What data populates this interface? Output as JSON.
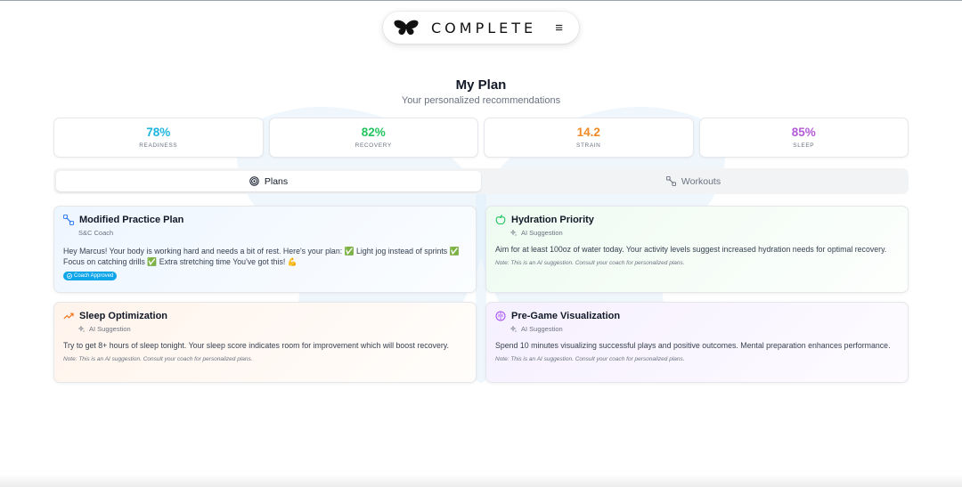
{
  "brand": {
    "name": "COMPLETE",
    "logo_icon": "butterfly-icon",
    "menu_icon": "hamburger-menu-icon"
  },
  "page": {
    "title": "My Plan",
    "subtitle": "Your personalized recommendations"
  },
  "stats": [
    {
      "value": "78%",
      "label": "READINESS",
      "color": "#1fb5df"
    },
    {
      "value": "82%",
      "label": "RECOVERY",
      "color": "#22c55e"
    },
    {
      "value": "14.2",
      "label": "STRAIN",
      "color": "#f08a24"
    },
    {
      "value": "85%",
      "label": "SLEEP",
      "color": "#b45ad6"
    }
  ],
  "tabs": [
    {
      "label": "Plans",
      "icon": "target-icon",
      "active": true
    },
    {
      "label": "Workouts",
      "icon": "dumbbell-icon",
      "active": false
    }
  ],
  "cards": [
    {
      "title": "Modified Practice Plan",
      "icon": "dumbbell-icon",
      "meta": "S&C Coach",
      "body": "Hey Marcus! Your body is working hard and needs a bit of rest. Here's your plan: ✅ Light jog instead of sprints ✅ Focus on catching drills ✅ Extra stretching time You've got this! 💪",
      "badge": "Coach Approved",
      "accent": "#3b82f6"
    },
    {
      "title": "Hydration Priority",
      "icon": "apple-icon",
      "meta": "AI Suggestion",
      "body": "Aim for at least 100oz of water today. Your activity levels suggest increased hydration needs for optimal recovery.",
      "note": "Note: This is an AI suggestion. Consult your coach for personalized plans.",
      "accent": "#22c55e"
    },
    {
      "title": "Sleep Optimization",
      "icon": "trending-up-icon",
      "meta": "AI Suggestion",
      "body": "Try to get 8+ hours of sleep tonight. Your sleep score indicates room for improvement which will boost recovery.",
      "note": "Note: This is an AI suggestion. Consult your coach for personalized plans.",
      "accent": "#f97316"
    },
    {
      "title": "Pre-Game Visualization",
      "icon": "brain-icon",
      "meta": "AI Suggestion",
      "body": "Spend 10 minutes visualizing successful plays and positive outcomes. Mental preparation enhances performance.",
      "note": "Note: This is an AI suggestion. Consult your coach for personalized plans.",
      "accent": "#a855f7"
    }
  ]
}
